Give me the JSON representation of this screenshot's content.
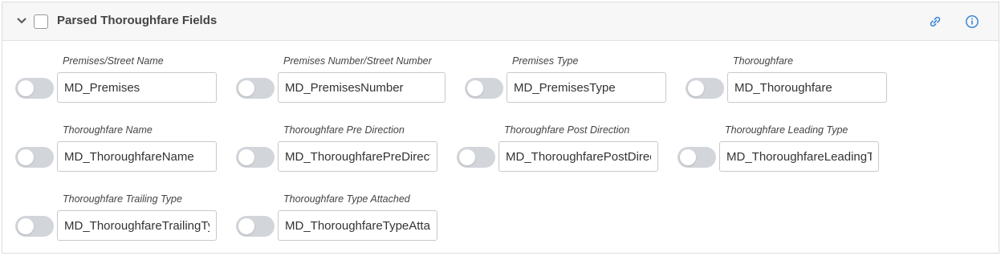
{
  "section": {
    "title": "Parsed Thoroughfare Fields",
    "header_icons": [
      "chevron-down-icon",
      "link-icon",
      "info-icon"
    ],
    "accent_color": "#3b86d6"
  },
  "fields": [
    {
      "label": "Premises/Street Name",
      "value": "MD_Premises"
    },
    {
      "label": "Premises Number/Street Number",
      "value": "MD_PremisesNumber"
    },
    {
      "label": "Premises Type",
      "value": "MD_PremisesType"
    },
    {
      "label": "Thoroughfare",
      "value": "MD_Thoroughfare"
    },
    {
      "label": "Thoroughfare Name",
      "value": "MD_ThoroughfareName"
    },
    {
      "label": "Thoroughfare Pre Direction",
      "value": "MD_ThoroughfarePreDirection"
    },
    {
      "label": "Thoroughfare Post Direction",
      "value": "MD_ThoroughfarePostDirection"
    },
    {
      "label": "Thoroughfare Leading Type",
      "value": "MD_ThoroughfareLeadingType"
    },
    {
      "label": "Thoroughfare Trailing Type",
      "value": "MD_ThoroughfareTrailingType"
    },
    {
      "label": "Thoroughfare Type Attached",
      "value": "MD_ThoroughfareTypeAttached"
    }
  ]
}
